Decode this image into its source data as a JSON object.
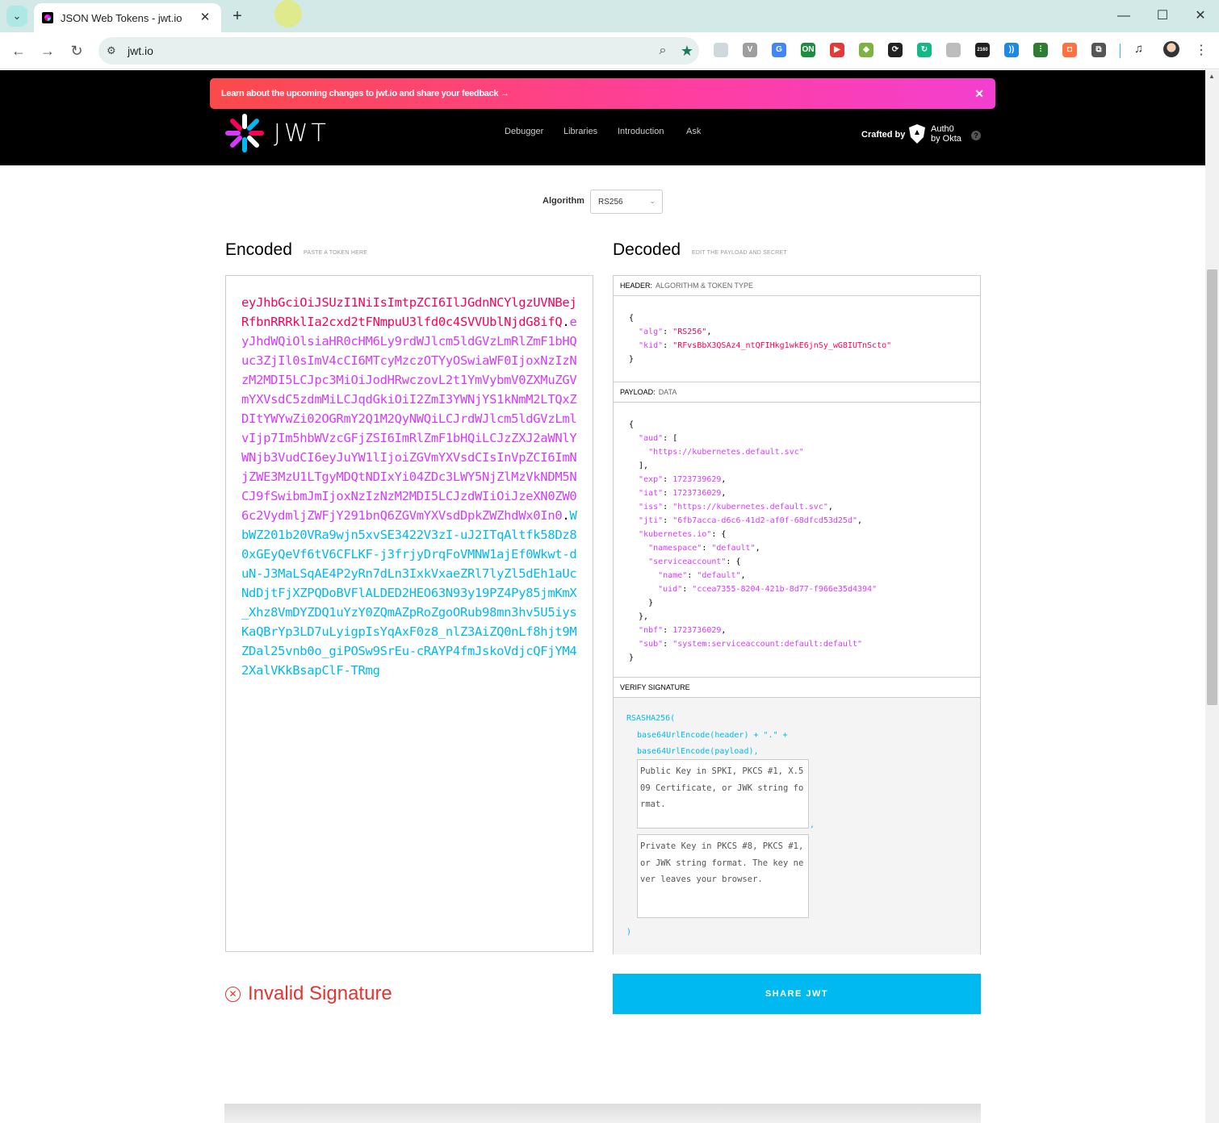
{
  "browser": {
    "tab_title": "JSON Web Tokens - jwt.io",
    "url": "jwt.io",
    "extensions": [
      {
        "icon": "ext-grid-icon",
        "color": "#cfd8dc",
        "text": ""
      },
      {
        "icon": "ext-v-icon",
        "color": "#9e9e9e",
        "text": "V"
      },
      {
        "icon": "ext-translate-icon",
        "color": "#4285f4",
        "text": "G"
      },
      {
        "icon": "ext-on-icon",
        "color": "#1e8e3e",
        "text": "ON"
      },
      {
        "icon": "ext-play-icon",
        "color": "#e53935",
        "text": "▶"
      },
      {
        "icon": "ext-android-icon",
        "color": "#7cb342",
        "text": "◆"
      },
      {
        "icon": "ext-sync-icon",
        "color": "#222222",
        "text": "⟳"
      },
      {
        "icon": "ext-refresh-green-icon",
        "color": "#12b886",
        "text": "↻"
      },
      {
        "icon": "ext-photo-icon",
        "color": "#bdbdbd",
        "text": ""
      },
      {
        "icon": "ext-2160-icon",
        "color": "#212121",
        "text": "2160"
      },
      {
        "icon": "ext-signal-icon",
        "color": "#1e88e5",
        "text": "))"
      },
      {
        "icon": "ext-equalizer-icon",
        "color": "#2e7d32",
        "text": "⫶"
      },
      {
        "icon": "ext-bag-icon",
        "color": "#ff7043",
        "text": "◘"
      },
      {
        "icon": "ext-puzzle-icon",
        "color": "#555555",
        "text": "⧉"
      }
    ]
  },
  "banner": {
    "text": "Learn about the upcoming changes to jwt.io and share your feedback →"
  },
  "header": {
    "logo_text": "JWT",
    "nav": [
      "Debugger",
      "Libraries",
      "Introduction",
      "Ask"
    ],
    "crafted_by": "Crafted by",
    "auth0_line1": "Auth0",
    "auth0_line2": "by Okta"
  },
  "algorithm": {
    "label": "Algorithm",
    "value": "RS256"
  },
  "encoded": {
    "title": "Encoded",
    "subtitle": "PASTE A TOKEN HERE",
    "header_part": "eyJhbGciOiJSUzI1NiIsImtpZCI6IlJGdnNCYlgzUVNBejRfbnRRRklIa2cxd2tFNmpuU3lfd0c4SVVUblNjdG8ifQ",
    "payload_part": "eyJhdWQiOlsiaHR0cHM6Ly9rdWJlcm5ldGVzLmRlZmF1bHQuc3ZjIl0sImV4cCI6MTcyMzczOTYyOSwiaWF0IjoxNzIzNzM2MDI5LCJpc3MiOiJodHRwczovL2t1YmVybmV0ZXMuZGVmYXVsdC5zdmMiLCJqdGkiOiI2ZmI3YWNjYS1kNmM2LTQxZDItYWYwZi02OGRmY2Q1M2QyNWQiLCJrdWJlcm5ldGVzLmlvIjp7Im5hbWVzcGFjZSI6ImRlZmF1bHQiLCJzZXJ2aWNlYWNjb3VudCI6eyJuYW1lIjoiZGVmYXVsdCIsInVpZCI6ImNjZWE3MzU1LTgyMDQtNDIxYi04ZDc3LWY5NjZlMzVkNDM5NCJ9fSwibmJmIjoxNzIzNzM2MDI5LCJzdWIiOiJzeXN0ZW06c2VydmljZWFjY291bnQ6ZGVmYXVsdDpkZWZhdWx0In0",
    "signature_part": "WbWZ201b20VRa9wjn5xvSE3422V3zI-uJ2ITqAltfk58Dz80xGEyQeVf6tV6CFLKF-j3frjyDrqFoVMNW1ajEf0Wkwt-duN-J3MaLSqAE4P2yRn7dLn3IxkVxaeZRl7lyZl5dEh1aUcNdDjtFjXZPQDoBVFlALDED2HEO63N93y19PZ4Py85jmKmX_Xhz8VmDYZDQ1uYzY0ZQmAZpRoZgoORub98mn3hv5U5iysKaQBrYp3LD7uLyigpIsYqAxF0z8_nlZ3AiZQ0nLf8hjt9MZDal25vnb0o_giPOSw9SrEu-cRAYP4fmJskoVdjcQFjYM42XalVKkBsapClF-TRmg",
    "dot": "."
  },
  "decoded": {
    "title": "Decoded",
    "subtitle": "EDIT THE PAYLOAD AND SECRET",
    "header_label": "HEADER:",
    "header_desc": "ALGORITHM & TOKEN TYPE",
    "header_json": {
      "alg": "RS256",
      "kid": "RFvsBbX3QSAz4_ntQFIHkg1wkE6jnSy_wG8IUTnScto"
    },
    "payload_label": "PAYLOAD:",
    "payload_desc": "DATA",
    "payload_json": {
      "aud_item": "https://kubernetes.default.svc",
      "exp": "1723739629",
      "iat": "1723736029",
      "iss": "https://kubernetes.default.svc",
      "jti": "6fb7acca-d6c6-41d2-af0f-68dfcd53d25d",
      "namespace": "default",
      "sa_name": "default",
      "sa_uid": "ccea7355-8204-421b-8d77-f966e35d4394",
      "nbf": "1723736029",
      "sub": "system:serviceaccount:default:default"
    },
    "verify_label": "VERIFY SIGNATURE",
    "verify_fn": "RSASHA256(",
    "verify_line2": "base64UrlEncode(header) + \".\" +",
    "verify_line3": "base64UrlEncode(payload),",
    "public_key_placeholder": "Public Key in SPKI, PKCS #1, X.509 Certificate, or JWK string format.",
    "private_key_placeholder": "Private Key in PKCS #8, PKCS #1, or JWK string format. The key never leaves your browser.",
    "comma": ",",
    "close_paren": ")"
  },
  "status": {
    "invalid_text": "Invalid Signature",
    "share_label": "SHARE JWT"
  }
}
